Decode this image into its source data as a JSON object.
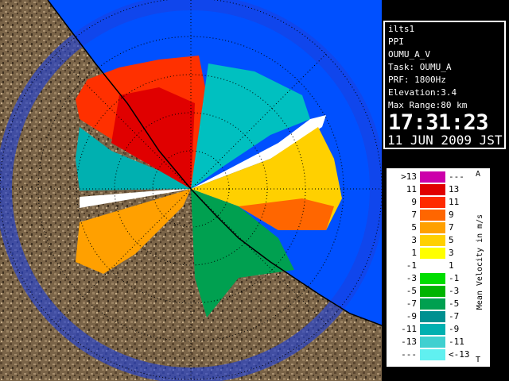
{
  "info": {
    "site": "ilts1",
    "scan_type": "PPI",
    "product": "OUMU_A_V",
    "task": "Task: OUMU_A",
    "prf": "PRF: 1800Hz",
    "elevation": "Elevation:3.4",
    "max_range": "Max Range:80 km",
    "time": "17:31:23",
    "date": "11 JUN 2009 JST"
  },
  "legend": {
    "title": "Mean Velocity in m/s",
    "corner_top": "A",
    "corner_bottom": "T",
    "rows": [
      {
        "left": ">13",
        "right": "---",
        "color": "#cc00aa"
      },
      {
        "left": "11",
        "right": "13",
        "color": "#e00000"
      },
      {
        "left": "9",
        "right": "11",
        "color": "#ff2a00"
      },
      {
        "left": "7",
        "right": "9",
        "color": "#ff6600"
      },
      {
        "left": "5",
        "right": "7",
        "color": "#ffa000"
      },
      {
        "left": "3",
        "right": "5",
        "color": "#ffd000"
      },
      {
        "left": "1",
        "right": "3",
        "color": "#ffff00"
      },
      {
        "left": "-1",
        "right": "1",
        "color": "#ffffff"
      },
      {
        "left": "-3",
        "right": "-1",
        "color": "#00dd00"
      },
      {
        "left": "-5",
        "right": "-3",
        "color": "#00b400"
      },
      {
        "left": "-7",
        "right": "-5",
        "color": "#00a050"
      },
      {
        "left": "-9",
        "right": "-7",
        "color": "#009090"
      },
      {
        "left": "-11",
        "right": "-9",
        "color": "#00b0b0"
      },
      {
        "left": "-13",
        "right": "-11",
        "color": "#40d0d0"
      },
      {
        "left": "---",
        "right": "<-13",
        "color": "#60f0f0"
      }
    ]
  }
}
